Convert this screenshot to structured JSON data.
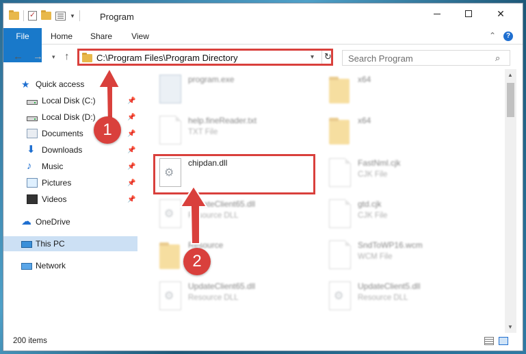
{
  "window": {
    "title": "Program",
    "controls": {
      "minimize": "minimize",
      "maximize": "maximize",
      "close": "✕"
    }
  },
  "ribbon": {
    "tabs": [
      {
        "label": "File"
      },
      {
        "label": "Home"
      },
      {
        "label": "Share"
      },
      {
        "label": "View"
      }
    ],
    "collapse_icon": "chevron-up-icon",
    "help_label": "?"
  },
  "nav": {
    "back": "←",
    "forward": "→",
    "recent": "▾",
    "up": "↑",
    "address": "C:\\Program Files\\Program Directory",
    "address_drop": "▾",
    "refresh": "↻",
    "search_placeholder": "Search Program",
    "search_icon": "⌕"
  },
  "sidebar": {
    "items": [
      {
        "label": "Quick access",
        "icon": "star-icon",
        "pinned": false
      },
      {
        "label": "Local Disk (C:)",
        "icon": "drive-icon",
        "pinned": true
      },
      {
        "label": "Local Disk (D:)",
        "icon": "drive-icon",
        "pinned": true
      },
      {
        "label": "Documents",
        "icon": "documents-icon",
        "pinned": true
      },
      {
        "label": "Downloads",
        "icon": "download-icon",
        "pinned": true
      },
      {
        "label": "Music",
        "icon": "music-icon",
        "pinned": true
      },
      {
        "label": "Pictures",
        "icon": "pictures-icon",
        "pinned": true
      },
      {
        "label": "Videos",
        "icon": "videos-icon",
        "pinned": true
      },
      {
        "label": "OneDrive",
        "icon": "cloud-icon",
        "pinned": false
      },
      {
        "label": "This PC",
        "icon": "computer-icon",
        "pinned": false,
        "selected": true
      },
      {
        "label": "Network",
        "icon": "network-icon",
        "pinned": false
      }
    ],
    "pin_glyph": "📌"
  },
  "files": [
    {
      "name": "program.exe",
      "type": "",
      "icon": "exe-icon",
      "blurred": true
    },
    {
      "name": "x64",
      "type": "",
      "icon": "folder-icon",
      "blurred": true
    },
    {
      "name": "help.fineReader.txt",
      "type": "TXT File",
      "icon": "document-icon",
      "blurred": true
    },
    {
      "name": "x64",
      "type": "",
      "icon": "folder-icon",
      "blurred": true
    },
    {
      "name": "chipdan.dll",
      "type": "",
      "icon": "dll-icon",
      "blurred": false
    },
    {
      "name": "FastNml.cjk",
      "type": "CJK File",
      "icon": "document-icon",
      "blurred": true
    },
    {
      "name": "UpdateClient65.dll",
      "type": "Resource DLL",
      "icon": "dll-icon",
      "blurred": true
    },
    {
      "name": "gtd.cjk",
      "type": "CJK File",
      "icon": "document-icon",
      "blurred": true
    },
    {
      "name": "Resource",
      "type": "",
      "icon": "folder-icon",
      "blurred": true
    },
    {
      "name": "SndToWP16.wcm",
      "type": "WCM File",
      "icon": "document-icon",
      "blurred": true
    },
    {
      "name": "UpdateClient65.dll",
      "type": "Resource DLL",
      "icon": "dll-icon",
      "blurred": true
    },
    {
      "name": "UpdateClient5.dll",
      "type": "Resource DLL",
      "icon": "dll-icon",
      "blurred": true
    }
  ],
  "status": {
    "items_count": "200 items"
  },
  "annotations": {
    "step1": "1",
    "step2": "2",
    "color": "#d9403c"
  },
  "colors": {
    "accent": "#1979ca",
    "highlight": "#d9403c",
    "selected_bg": "#cce0f4"
  }
}
